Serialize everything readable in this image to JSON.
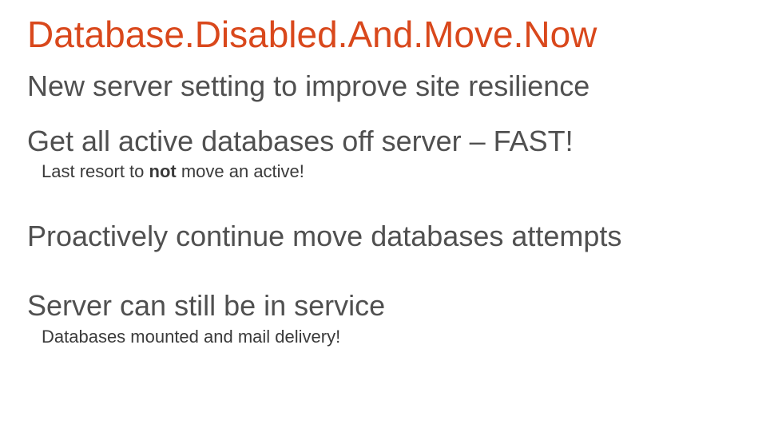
{
  "title": "Database.Disabled.And.Move.Now",
  "blocks": {
    "b1": {
      "heading": "New server setting to improve site resilience"
    },
    "b2": {
      "heading": "Get all active databases off server – FAST!",
      "sub_prefix": "Last resort to ",
      "sub_strong": "not",
      "sub_suffix": " move an active!"
    },
    "b3": {
      "heading": "Proactively continue move databases attempts"
    },
    "b4": {
      "heading": "Server can still be in service",
      "sub": "Databases mounted and mail delivery!"
    }
  }
}
